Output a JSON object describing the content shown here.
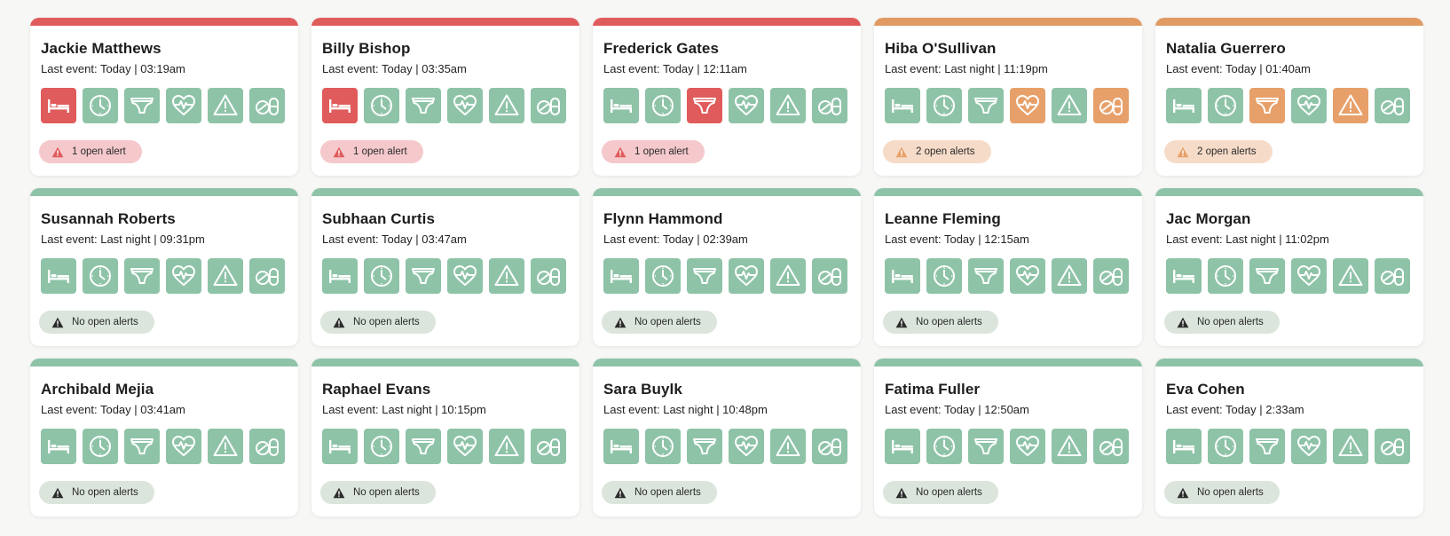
{
  "colors": {
    "alert_red": "#e05b5b",
    "alert_orange": "#e7a069",
    "ok_green": "#8ec3a8"
  },
  "icon_names": [
    "bed-icon",
    "clock-icon",
    "underwear-icon",
    "heart-rate-icon",
    "warning-icon",
    "pills-icon"
  ],
  "residents": [
    {
      "name": "Jackie Matthews",
      "last_event": "Last event: Today | 03:19am",
      "status": "red",
      "alert_text": "1 open alert",
      "icon_states": [
        "red",
        "green",
        "green",
        "green",
        "green",
        "green"
      ]
    },
    {
      "name": "Billy Bishop",
      "last_event": "Last event: Today | 03:35am",
      "status": "red",
      "alert_text": "1 open alert",
      "icon_states": [
        "red",
        "green",
        "green",
        "green",
        "green",
        "green"
      ]
    },
    {
      "name": "Frederick Gates",
      "last_event": "Last event: Today | 12:11am",
      "status": "red",
      "alert_text": "1 open alert",
      "icon_states": [
        "green",
        "green",
        "red",
        "green",
        "green",
        "green"
      ]
    },
    {
      "name": "Hiba O'Sullivan",
      "last_event": "Last event: Last night | 11:19pm",
      "status": "orange",
      "alert_text": "2 open alerts",
      "icon_states": [
        "green",
        "green",
        "green",
        "orange",
        "green",
        "orange"
      ]
    },
    {
      "name": "Natalia Guerrero",
      "last_event": "Last event: Today | 01:40am",
      "status": "orange",
      "alert_text": "2 open alerts",
      "icon_states": [
        "green",
        "green",
        "orange",
        "green",
        "orange",
        "green"
      ]
    },
    {
      "name": "Susannah Roberts",
      "last_event": "Last event: Last night | 09:31pm",
      "status": "green",
      "alert_text": "No open alerts",
      "icon_states": [
        "green",
        "green",
        "green",
        "green",
        "green",
        "green"
      ]
    },
    {
      "name": "Subhaan Curtis",
      "last_event": "Last event: Today | 03:47am",
      "status": "green",
      "alert_text": "No open alerts",
      "icon_states": [
        "green",
        "green",
        "green",
        "green",
        "green",
        "green"
      ]
    },
    {
      "name": "Flynn Hammond",
      "last_event": "Last event: Today | 02:39am",
      "status": "green",
      "alert_text": "No open alerts",
      "icon_states": [
        "green",
        "green",
        "green",
        "green",
        "green",
        "green"
      ]
    },
    {
      "name": "Leanne Fleming",
      "last_event": "Last event: Today | 12:15am",
      "status": "green",
      "alert_text": "No open alerts",
      "icon_states": [
        "green",
        "green",
        "green",
        "green",
        "green",
        "green"
      ]
    },
    {
      "name": "Jac Morgan",
      "last_event": "Last event: Last night | 11:02pm",
      "status": "green",
      "alert_text": "No open alerts",
      "icon_states": [
        "green",
        "green",
        "green",
        "green",
        "green",
        "green"
      ]
    },
    {
      "name": "Archibald Mejia",
      "last_event": "Last event: Today | 03:41am",
      "status": "green",
      "alert_text": "No open alerts",
      "icon_states": [
        "green",
        "green",
        "green",
        "green",
        "green",
        "green"
      ]
    },
    {
      "name": "Raphael Evans",
      "last_event": "Last event: Last night | 10:15pm",
      "status": "green",
      "alert_text": "No open alerts",
      "icon_states": [
        "green",
        "green",
        "green",
        "green",
        "green",
        "green"
      ]
    },
    {
      "name": "Sara Buylk",
      "last_event": "Last event: Last night | 10:48pm",
      "status": "green",
      "alert_text": "No open alerts",
      "icon_states": [
        "green",
        "green",
        "green",
        "green",
        "green",
        "green"
      ]
    },
    {
      "name": "Fatima Fuller",
      "last_event": "Last event: Today | 12:50am",
      "status": "green",
      "alert_text": "No open alerts",
      "icon_states": [
        "green",
        "green",
        "green",
        "green",
        "green",
        "green"
      ]
    },
    {
      "name": "Eva Cohen",
      "last_event": "Last event: Today | 2:33am",
      "status": "green",
      "alert_text": "No open alerts",
      "icon_states": [
        "green",
        "green",
        "green",
        "green",
        "green",
        "green"
      ]
    }
  ]
}
